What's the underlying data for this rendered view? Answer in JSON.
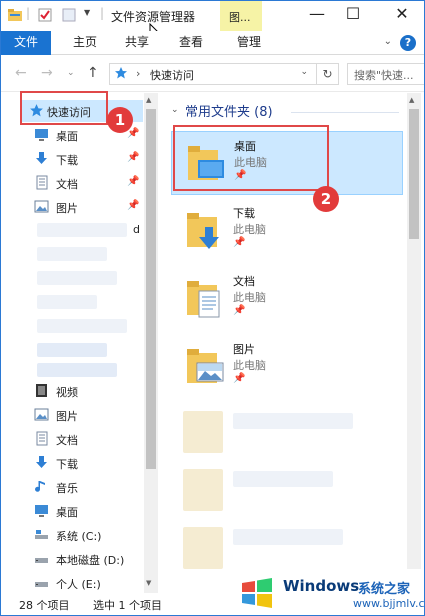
{
  "window": {
    "title": "文件资源管理器",
    "context_tab": "图...",
    "controls": {
      "minimize": "—",
      "maximize": "☐",
      "close": "✕"
    }
  },
  "ribbon": {
    "tabs": [
      "文件",
      "主页",
      "共享",
      "查看",
      "管理"
    ],
    "help": "?"
  },
  "address": {
    "path": "快速访问",
    "search_placeholder": "搜索\"快速..."
  },
  "nav": {
    "quick_access": "快速访问",
    "pinned": [
      {
        "label": "桌面",
        "icon": "desktop-icon"
      },
      {
        "label": "下载",
        "icon": "download-icon"
      },
      {
        "label": "文档",
        "icon": "document-icon"
      },
      {
        "label": "图片",
        "icon": "pictures-icon"
      }
    ],
    "partial_text": "d",
    "this_pc": [
      {
        "label": "视频",
        "icon": "video-icon"
      },
      {
        "label": "图片",
        "icon": "pictures-icon"
      },
      {
        "label": "文档",
        "icon": "document-icon"
      },
      {
        "label": "下载",
        "icon": "download-icon"
      },
      {
        "label": "音乐",
        "icon": "music-icon"
      },
      {
        "label": "桌面",
        "icon": "desktop-icon"
      },
      {
        "label": "系统 (C:)",
        "icon": "system-drive-icon"
      },
      {
        "label": "本地磁盘 (D:)",
        "icon": "drive-icon"
      },
      {
        "label": "个人 (E:)",
        "icon": "drive-icon"
      }
    ]
  },
  "content": {
    "group_header": "常用文件夹 (8)",
    "items": [
      {
        "name": "桌面",
        "location": "此电脑",
        "icon": "desktop-folder-icon",
        "selected": true
      },
      {
        "name": "下载",
        "location": "此电脑",
        "icon": "download-folder-icon",
        "selected": false
      },
      {
        "name": "文档",
        "location": "此电脑",
        "icon": "documents-folder-icon",
        "selected": false
      },
      {
        "name": "图片",
        "location": "此电脑",
        "icon": "pictures-folder-icon",
        "selected": false
      }
    ]
  },
  "annotations": {
    "badge1": "1",
    "badge2": "2"
  },
  "status": {
    "count": "28 个项目",
    "selected": "选中 1 个项目"
  },
  "watermark": {
    "brand": "Windows",
    "site_name": "系统之家",
    "url": "www.bjjmlv.com"
  },
  "colors": {
    "accent": "#1a73d1",
    "selection": "#cce8ff",
    "annotation": "#e23b3b",
    "folder": "#f2c75a"
  }
}
